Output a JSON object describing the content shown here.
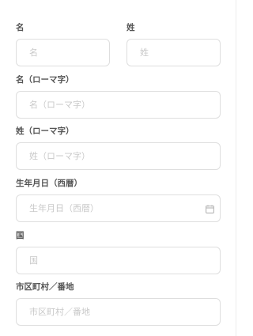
{
  "form": {
    "first_name": {
      "label": "名",
      "placeholder": "名",
      "value": ""
    },
    "last_name": {
      "label": "姓",
      "placeholder": "姓",
      "value": ""
    },
    "first_name_roman": {
      "label": "名（ローマ字）",
      "placeholder": "名（ローマ字）",
      "value": ""
    },
    "last_name_roman": {
      "label": "姓（ローマ字）",
      "placeholder": "姓（ローマ字）",
      "value": ""
    },
    "birthdate": {
      "label": "生年月日（西暦）",
      "placeholder": "生年月日（西暦）",
      "value": "",
      "icon": "calendar-icon"
    },
    "country": {
      "label": "国",
      "placeholder": "国",
      "value": ""
    },
    "city_address": {
      "label": "市区町村／番地",
      "placeholder": "市区町村／番地",
      "value": ""
    }
  },
  "colors": {
    "label": "#555555",
    "placeholder": "#c9c9c9",
    "border": "#dedede",
    "icon": "#b5b5b5"
  }
}
